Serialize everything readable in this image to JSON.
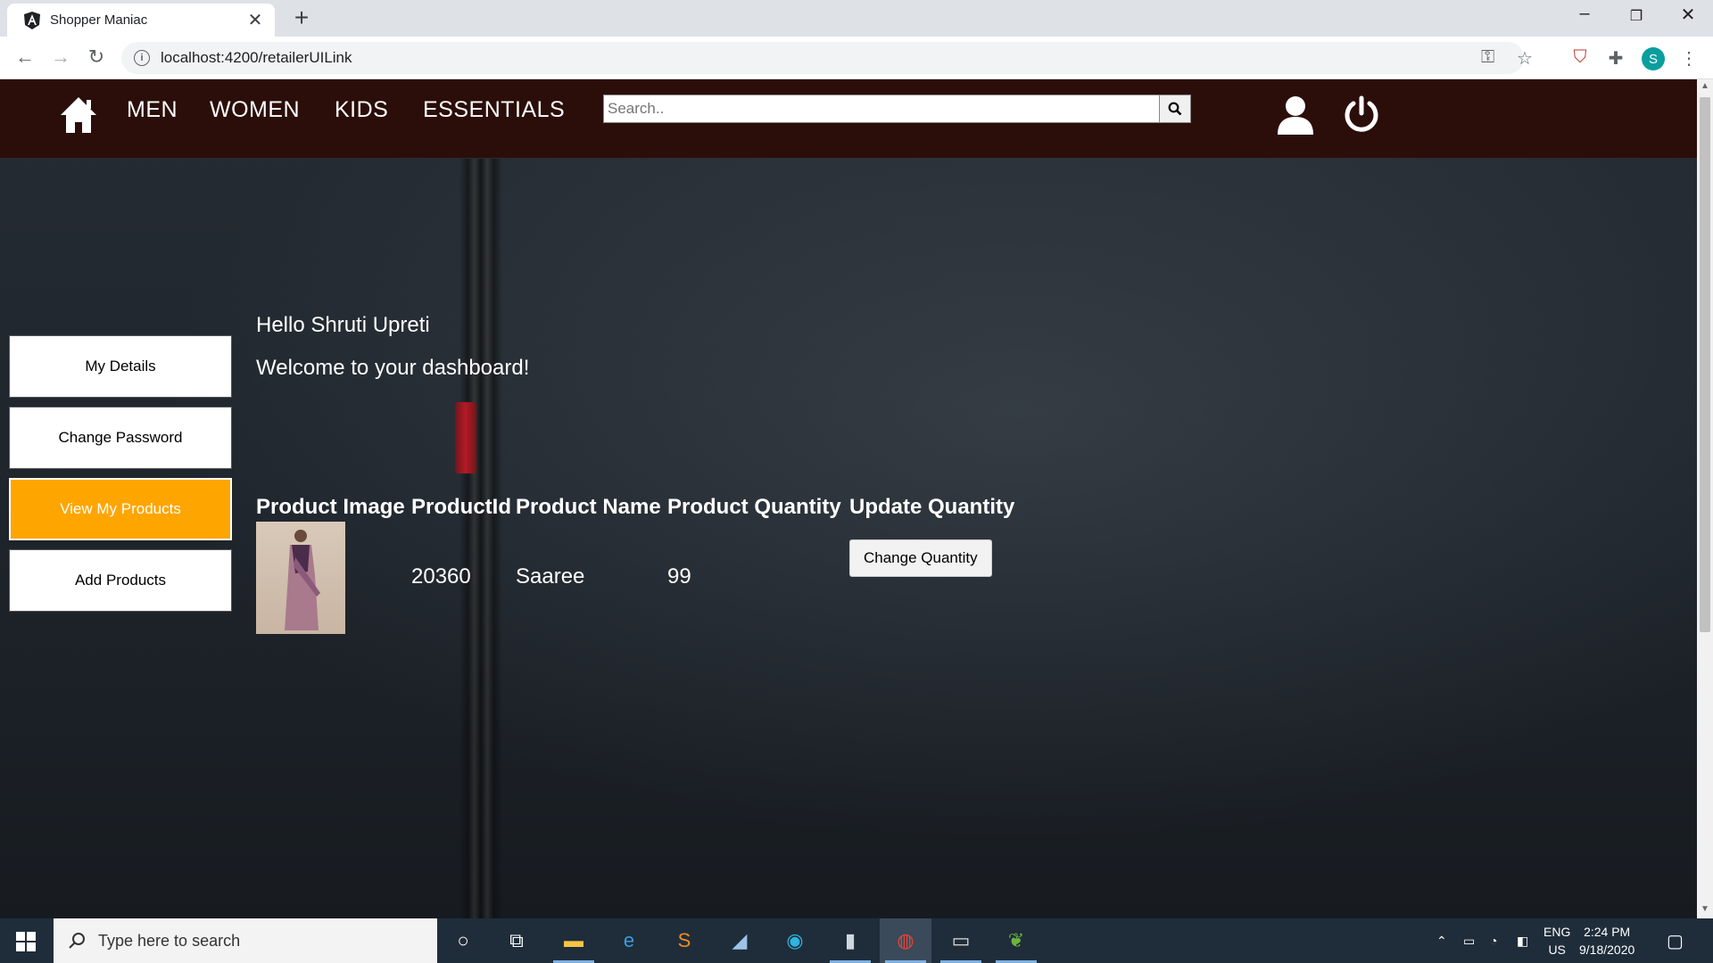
{
  "browser": {
    "tab_title": "Shopper Maniac",
    "tab_close": "✕",
    "new_tab": "+",
    "url": "localhost:4200/retailerUILink",
    "profile_initial": "S",
    "window_controls": {
      "minimize": "–",
      "maximize": "❐",
      "close": "✕"
    }
  },
  "header": {
    "nav": [
      "MEN",
      "WOMEN",
      "KIDS",
      "ESSENTIALS"
    ],
    "search_placeholder": "Search..",
    "colors": {
      "background": "#2b0e0a",
      "text": "#ffffff"
    }
  },
  "sidebar": {
    "items": [
      {
        "label": "My Details"
      },
      {
        "label": "Change Password"
      },
      {
        "label": "View My Products"
      },
      {
        "label": "Add Products"
      }
    ],
    "active_color": "#ffa500"
  },
  "main": {
    "greeting": "Hello Shruti Upreti",
    "welcome": "Welcome to your dashboard!",
    "table": {
      "headers": [
        "Product Image",
        "ProductId",
        "Product Name",
        "Product Quantity",
        "Update Quantity"
      ],
      "rows": [
        {
          "product_id": "20360",
          "name": "Saaree",
          "quantity": "99",
          "action": "Change Quantity"
        }
      ]
    }
  },
  "taskbar": {
    "search_placeholder": "Type here to search",
    "lang_top": "ENG",
    "lang_bottom": "US",
    "time": "2:24 PM",
    "date": "9/18/2020"
  }
}
